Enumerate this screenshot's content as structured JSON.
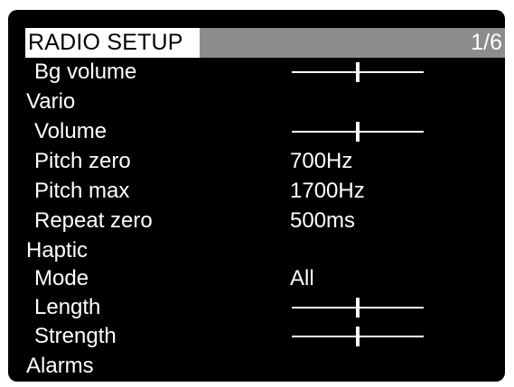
{
  "header": {
    "title": "RADIO SETUP",
    "page": "1/6"
  },
  "rows": [
    {
      "label": "Bg volume",
      "kind": "slider",
      "level": 0.5
    },
    {
      "label": "Vario",
      "kind": "section"
    },
    {
      "label": "Volume",
      "kind": "slider",
      "level": 0.5
    },
    {
      "label": "Pitch zero",
      "kind": "value",
      "value": "700Hz"
    },
    {
      "label": "Pitch max",
      "kind": "value",
      "value": "1700Hz"
    },
    {
      "label": "Repeat zero",
      "kind": "value",
      "value": "500ms"
    },
    {
      "label": "Haptic",
      "kind": "section"
    },
    {
      "label": "Mode",
      "kind": "value",
      "value": "All"
    },
    {
      "label": "Length",
      "kind": "slider",
      "level": 0.5
    },
    {
      "label": "Strength",
      "kind": "slider",
      "level": 0.5
    },
    {
      "label": "Alarms",
      "kind": "section"
    }
  ],
  "colors": {
    "screen_bg": "#000000",
    "title_highlight": "#ffffff",
    "title_bar": "#8c8c8c",
    "text": "#ffffff"
  }
}
